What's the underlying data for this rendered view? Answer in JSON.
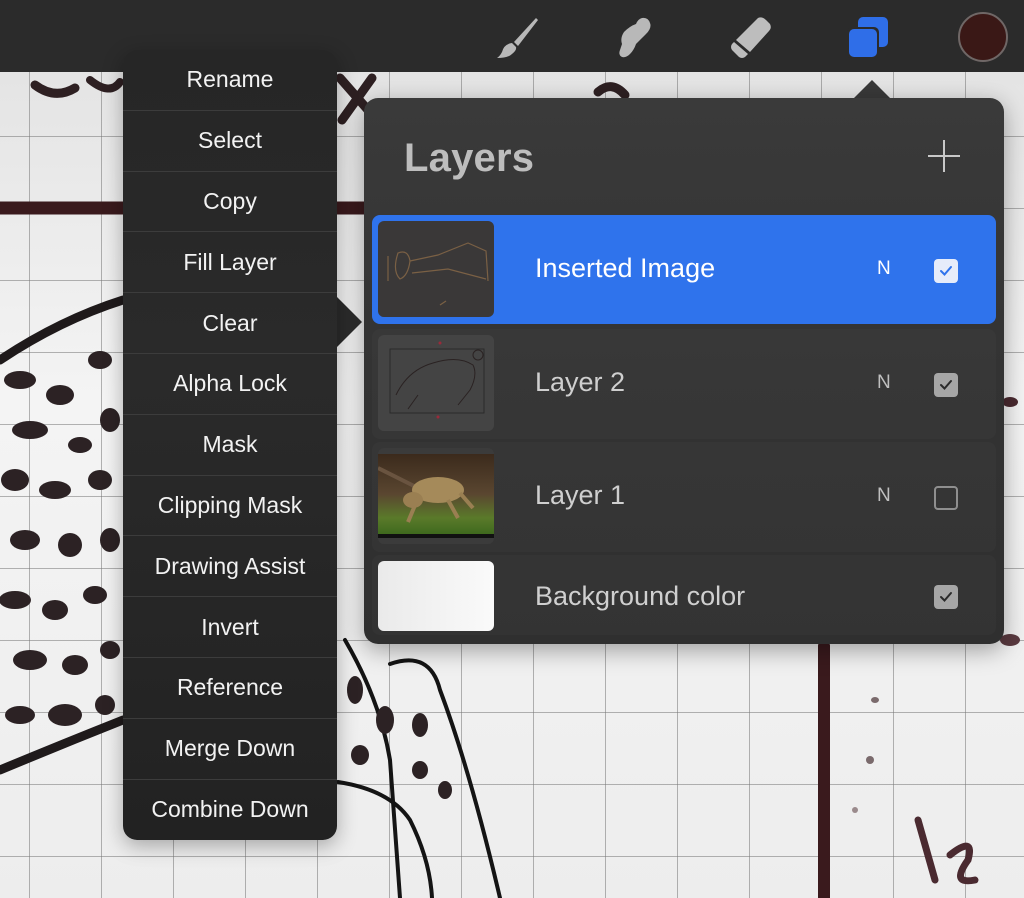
{
  "toolbar": {
    "tools": [
      {
        "name": "brush",
        "icon": "paintbrush-icon",
        "active": false
      },
      {
        "name": "smudge",
        "icon": "smudge-finger-icon",
        "active": false
      },
      {
        "name": "eraser",
        "icon": "eraser-icon",
        "active": false
      },
      {
        "name": "layers",
        "icon": "layers-icon",
        "active": true
      }
    ],
    "current_color": "#3a1816",
    "accent_color": "#2f73ec"
  },
  "layers_panel": {
    "title": "Layers",
    "add_icon": "plus-icon",
    "layers": [
      {
        "name": "Inserted Image",
        "blend_mode": "N",
        "visible": true,
        "selected": true
      },
      {
        "name": "Layer 2",
        "blend_mode": "N",
        "visible": true,
        "selected": false
      },
      {
        "name": "Layer 1",
        "blend_mode": "N",
        "visible": false,
        "selected": false
      },
      {
        "name": "Background color",
        "blend_mode": "",
        "visible": true,
        "selected": false
      }
    ]
  },
  "context_menu": {
    "items": [
      "Rename",
      "Select",
      "Copy",
      "Fill Layer",
      "Clear",
      "Alpha Lock",
      "Mask",
      "Clipping Mask",
      "Drawing Assist",
      "Invert",
      "Reference",
      "Merge Down",
      "Combine Down"
    ]
  }
}
